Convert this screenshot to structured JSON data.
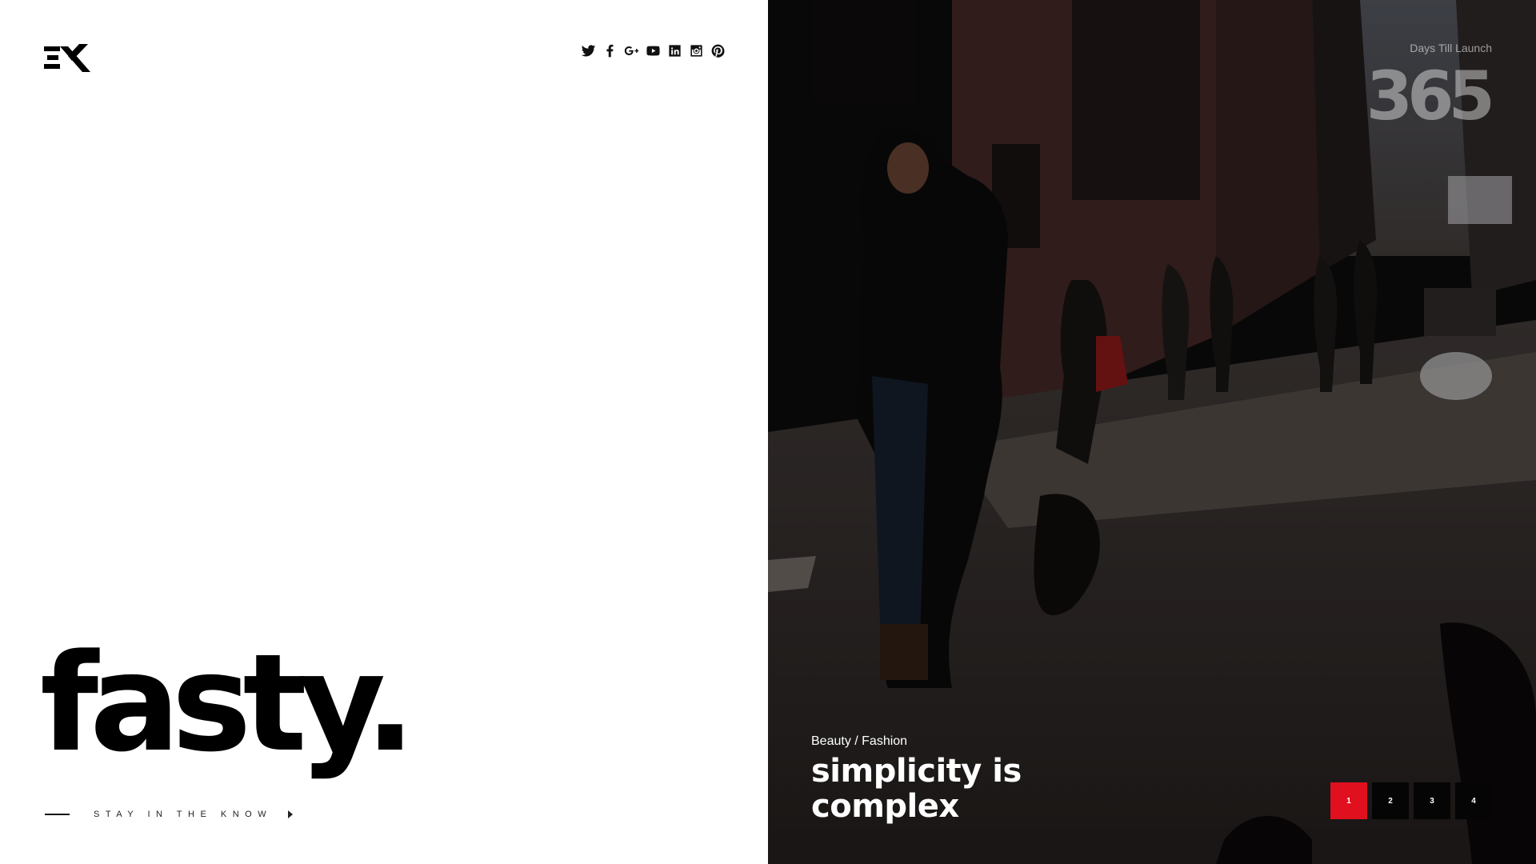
{
  "brand": {
    "wordmark": "fasty.",
    "logo_icon": "ex-logo-icon"
  },
  "social": [
    {
      "name": "twitter",
      "icon": "twitter-icon"
    },
    {
      "name": "facebook",
      "icon": "facebook-icon"
    },
    {
      "name": "google-plus",
      "icon": "google-plus-icon"
    },
    {
      "name": "youtube",
      "icon": "youtube-icon"
    },
    {
      "name": "linkedin",
      "icon": "linkedin-icon"
    },
    {
      "name": "instagram",
      "icon": "instagram-icon"
    },
    {
      "name": "pinterest",
      "icon": "pinterest-icon"
    }
  ],
  "cta": {
    "label": "STAY IN THE KNOW",
    "icon": "caret-right-icon"
  },
  "countdown": {
    "label": "Days Till Launch",
    "value": "365"
  },
  "slide": {
    "category": "Beauty / Fashion",
    "headline_line1": "simplicity is",
    "headline_line2": "complex"
  },
  "pager": {
    "pages": [
      "1",
      "2",
      "3",
      "4"
    ],
    "active": "1",
    "active_color": "#e0101e"
  },
  "colors": {
    "accent": "#e0101e",
    "text": "#000000"
  }
}
